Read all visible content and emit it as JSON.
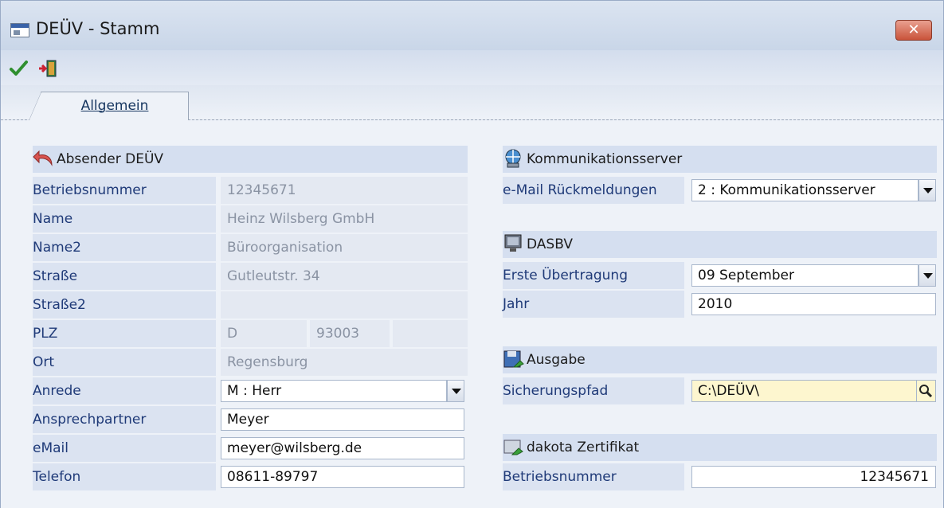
{
  "window": {
    "title": "DEÜV - Stamm",
    "close_label": "✕"
  },
  "toolbar": {
    "ok_icon": "checkmark-icon",
    "exit_icon": "exit-door-icon"
  },
  "tabs": [
    {
      "label": "Allgemein",
      "active": true
    }
  ],
  "absender": {
    "header": "Absender DEÜV",
    "betriebsnummer_label": "Betriebsnummer",
    "betriebsnummer": "12345671",
    "name_label": "Name",
    "name": "Heinz Wilsberg GmbH",
    "name2_label": "Name2",
    "name2": "Büroorganisation",
    "strasse_label": "Straße",
    "strasse": "Gutleutstr. 34",
    "strasse2_label": "Straße2",
    "strasse2": "",
    "plz_label": "PLZ",
    "plz_country": "D",
    "plz": "93003",
    "ort_label": "Ort",
    "ort": "Regensburg",
    "anrede_label": "Anrede",
    "anrede": "M : Herr",
    "ansprechpartner_label": "Ansprechpartner",
    "ansprechpartner": "Meyer",
    "email_label": "eMail",
    "email": "meyer@wilsberg.de",
    "telefon_label": "Telefon",
    "telefon": "08611-89797"
  },
  "kommunikation": {
    "header": "Kommunikationsserver",
    "email_rueck_label": "e-Mail Rückmeldungen",
    "email_rueck": "2 : Kommunikationsserver"
  },
  "dasbv": {
    "header": "DASBV",
    "erste_label": "Erste Übertragung",
    "erste": "09 September",
    "jahr_label": "Jahr",
    "jahr": "2010"
  },
  "ausgabe": {
    "header": "Ausgabe",
    "pfad_label": "Sicherungspfad",
    "pfad": "C:\\DEÜV\\"
  },
  "dakota": {
    "header": "dakota Zertifikat",
    "betriebsnummer_label": "Betriebsnummer",
    "betriebsnummer": "12345671"
  },
  "colors": {
    "label_text": "#1f3a78",
    "readonly_text": "#8a93a3",
    "section_bg": "#d5dff0",
    "highlight_field": "#fdf6cf"
  }
}
